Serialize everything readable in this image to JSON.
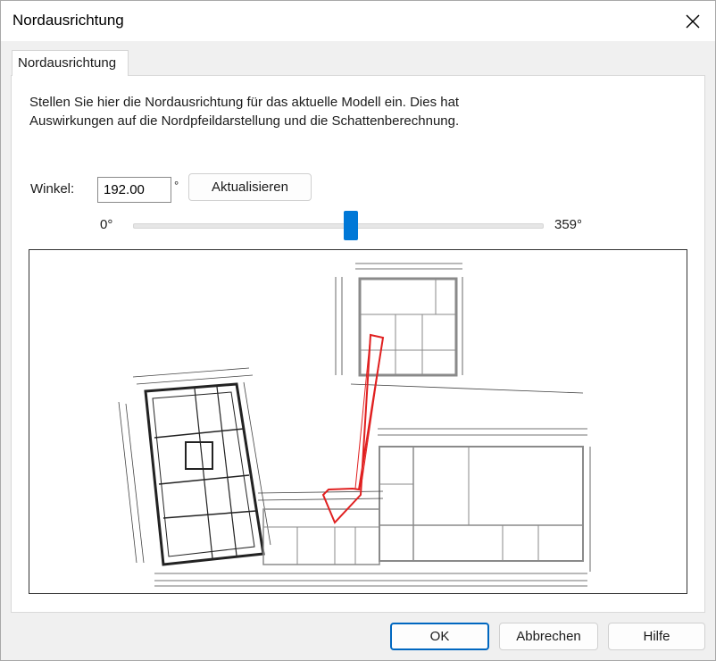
{
  "window": {
    "title": "Nordausrichtung"
  },
  "tab": {
    "label": "Nordausrichtung"
  },
  "description": {
    "line1": "Stellen Sie hier die Nordausrichtung für das aktuelle Modell ein. Dies hat",
    "line2": "Auswirkungen auf die Nordpfeildarstellung und die Schattenberechnung."
  },
  "angle": {
    "label": "Winkel:",
    "value": "192.00",
    "unit": "°",
    "update_button": "Aktualisieren"
  },
  "slider": {
    "min_label": "0°",
    "max_label": "359°",
    "value_degrees": 192
  },
  "footer": {
    "ok": "OK",
    "cancel": "Abbrechen",
    "help": "Hilfe"
  },
  "colors": {
    "accent": "#0078d7",
    "north_arrow": "#e02020",
    "plan_dark": "#222222",
    "plan_grey": "#9a9a9a"
  },
  "icons": {
    "close": "close-icon",
    "north_arrow": "north-arrow-icon"
  }
}
